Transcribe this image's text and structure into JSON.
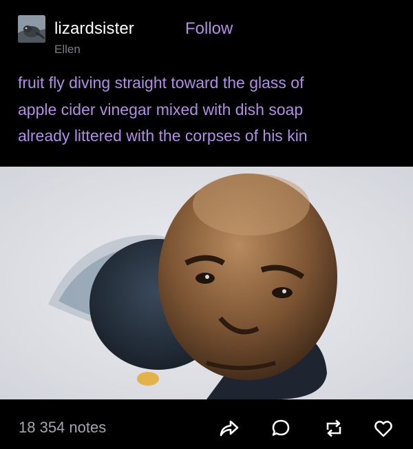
{
  "post": {
    "blog_name": "lizardsister",
    "follow_label": "Follow",
    "blog_title": "Ellen",
    "body_text": "fruit fly diving straight toward the glass of\napple cider vinegar mixed with dish soap\nalready littered with the corpses of his kin",
    "notes": "18 354 notes"
  },
  "icons": {
    "avatar": "lizard-avatar",
    "share": "share-icon",
    "reply": "reply-icon",
    "reblog": "reblog-icon",
    "like": "heart-icon"
  },
  "colors": {
    "background": "#000000",
    "accent": "#b48ce8",
    "muted": "#a6a6ad"
  }
}
